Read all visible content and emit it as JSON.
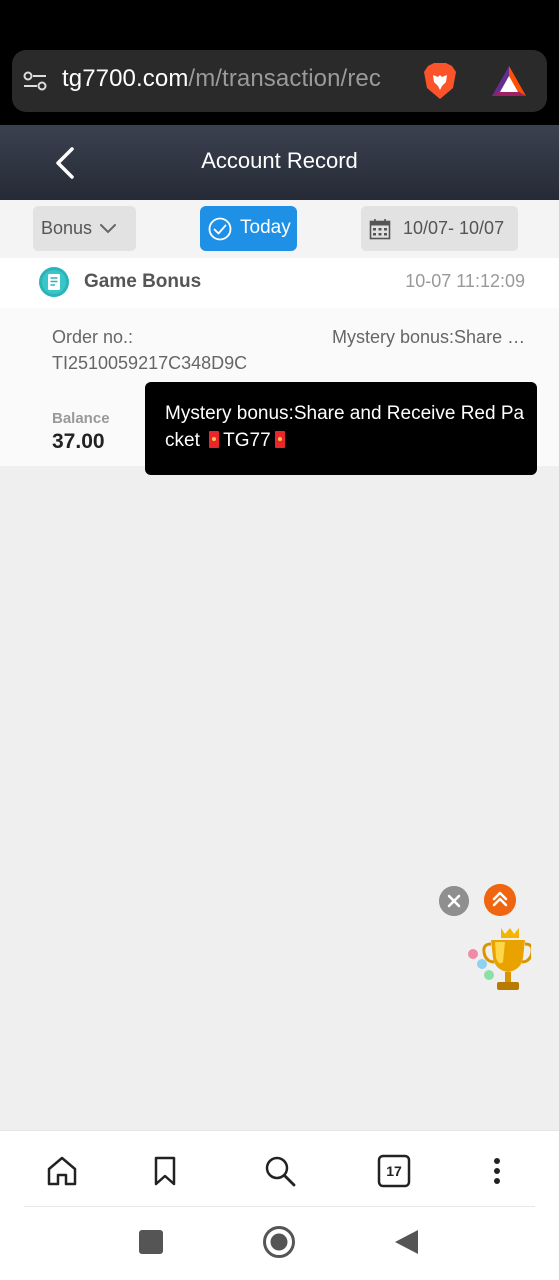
{
  "browser": {
    "url_host": "tg7700.com",
    "url_path": "/m/transaction/rec",
    "tab_count": "17"
  },
  "header": {
    "title": "Account Record"
  },
  "filters": {
    "type_label": "Bonus",
    "today_label": "Today",
    "date_range": "10/07- 10/07"
  },
  "record": {
    "title": "Game Bonus",
    "time": "10-07 11:12:09",
    "order_label": "Order no.:",
    "order_no": "TI2510059217C348D9C",
    "description": "Mystery bonus:Share and Receive Red Packet",
    "balance_label": "Balance",
    "balance_value": "37.00"
  },
  "tooltip": {
    "text_main": "Mystery bonus:Share and Receive Red Packet",
    "text_brand": "TG77"
  },
  "colors": {
    "header_bg": "#2f3440",
    "accent_blue": "#1e90e6",
    "float_orange": "#f0650f"
  },
  "icons": {
    "tune": "tune-icon",
    "brave": "brave-lion-icon",
    "bat": "bat-triangle-icon",
    "back": "chevron-left-icon",
    "home": "home-icon",
    "bookmark": "bookmark-icon",
    "search": "search-icon",
    "tabs": "tabs-icon",
    "more": "more-vertical-icon"
  }
}
